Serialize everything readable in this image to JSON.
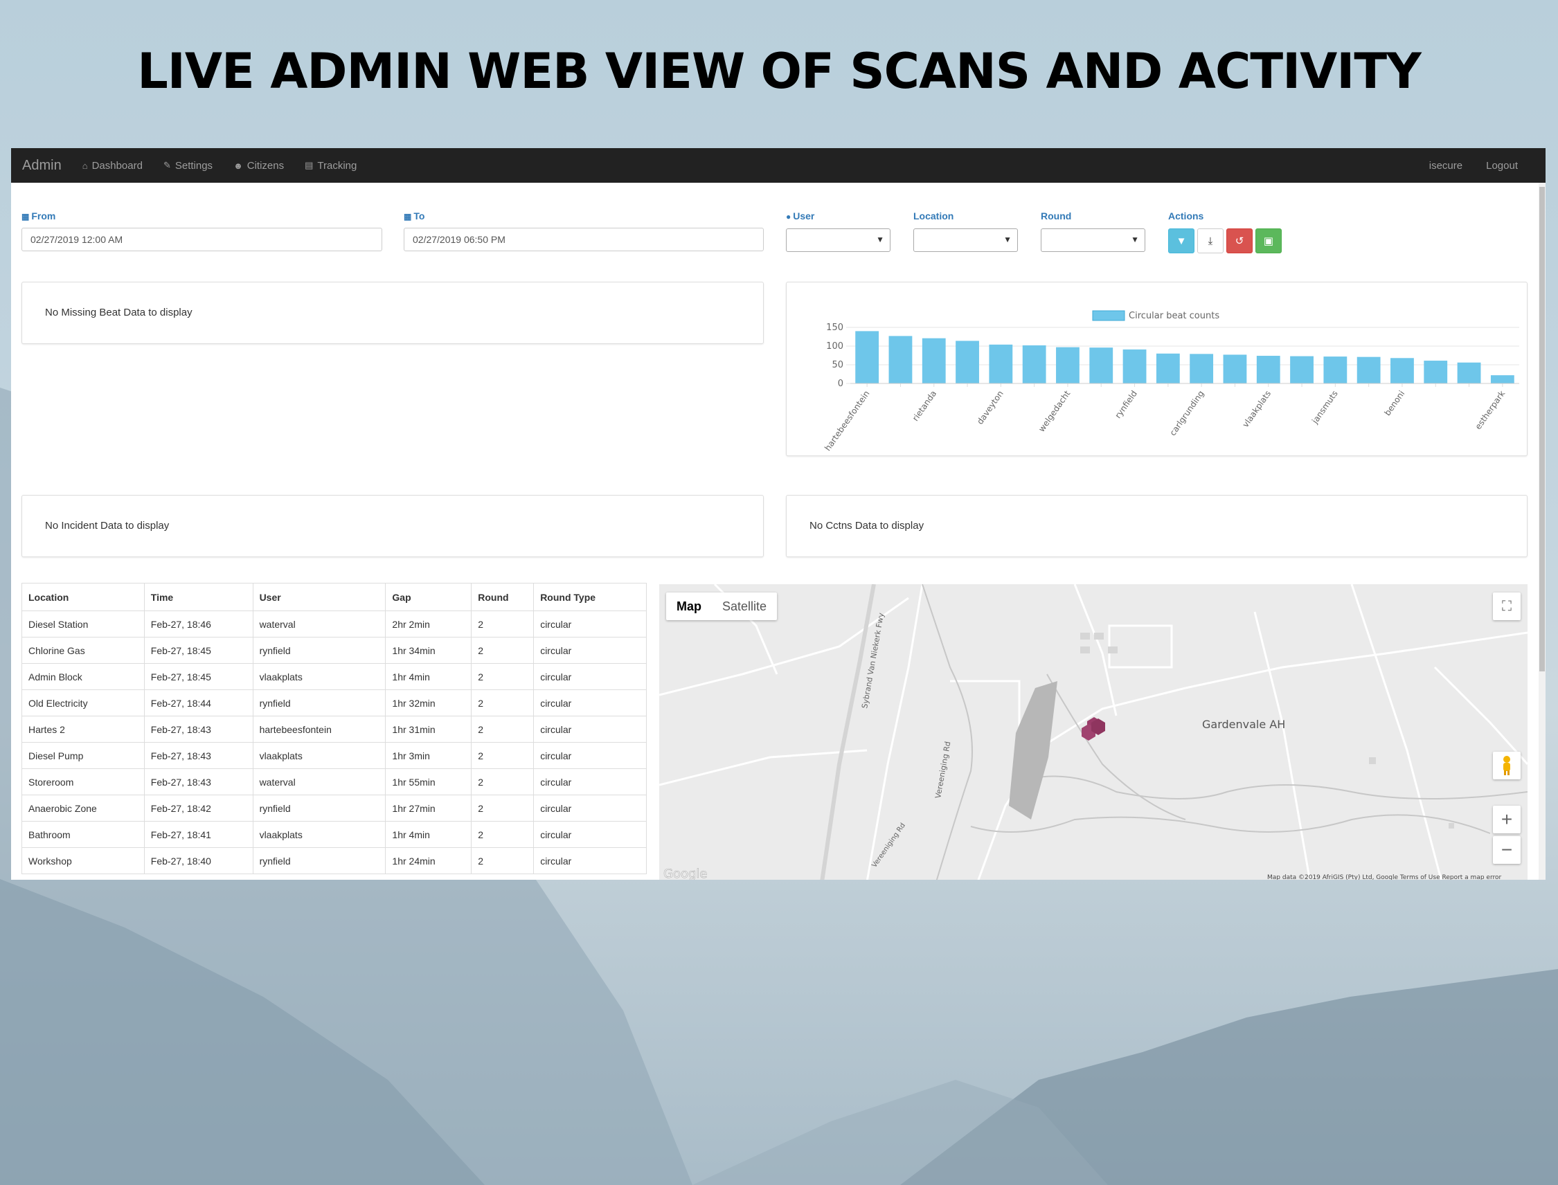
{
  "headline": "LIVE ADMIN WEB VIEW OF SCANS AND ACTIVITY",
  "navbar": {
    "brand": "Admin",
    "items": [
      {
        "label": "Dashboard",
        "icon": "home-icon"
      },
      {
        "label": "Settings",
        "icon": "wrench-icon"
      },
      {
        "label": "Citizens",
        "icon": "users-icon"
      },
      {
        "label": "Tracking",
        "icon": "map-icon"
      }
    ],
    "user": "isecure",
    "logout": "Logout"
  },
  "filters": {
    "from_label": "From",
    "from_value": "02/27/2019 12:00 AM",
    "to_label": "To",
    "to_value": "02/27/2019 06:50 PM",
    "user_label": "User",
    "location_label": "Location",
    "round_label": "Round",
    "actions_label": "Actions"
  },
  "actions": [
    {
      "name": "filter-button",
      "icon": "filter-icon",
      "color": "#5bc0de"
    },
    {
      "name": "download-button",
      "icon": "download-icon",
      "color": "#ffffff"
    },
    {
      "name": "reset-button",
      "icon": "undo-icon",
      "color": "#d9534f"
    },
    {
      "name": "image-button",
      "icon": "image-icon",
      "color": "#5cb85c"
    }
  ],
  "panels": {
    "missing_beat": "No Missing Beat Data to display",
    "incident": "No Incident Data to display",
    "cctns": "No Cctns Data to display"
  },
  "chart_data": {
    "type": "bar",
    "legend": "Circular beat counts",
    "color": "#6ec6ea",
    "ylim": [
      0,
      150
    ],
    "yticks": [
      "150",
      "100",
      "50",
      "0"
    ],
    "categories": [
      "hartebeesfontein",
      "",
      "rietanda",
      "",
      "daveyton",
      "",
      "welgedacht",
      "",
      "rynfield",
      "",
      "carlgrunding",
      "",
      "vlaakplats",
      "",
      "jansmuts",
      "",
      "benoni",
      "",
      "",
      "estherpark"
    ],
    "values": [
      140,
      127,
      121,
      114,
      104,
      102,
      97,
      96,
      91,
      80,
      79,
      77,
      74,
      73,
      72,
      71,
      68,
      61,
      56,
      22
    ]
  },
  "table": {
    "headers": [
      "Location",
      "Time",
      "User",
      "Gap",
      "Round",
      "Round Type"
    ],
    "rows": [
      [
        "Diesel Station",
        "Feb-27, 18:46",
        "waterval",
        "2hr 2min",
        "2",
        "circular"
      ],
      [
        "Chlorine Gas",
        "Feb-27, 18:45",
        "rynfield",
        "1hr 34min",
        "2",
        "circular"
      ],
      [
        "Admin Block",
        "Feb-27, 18:45",
        "vlaakplats",
        "1hr 4min",
        "2",
        "circular"
      ],
      [
        "Old Electricity",
        "Feb-27, 18:44",
        "rynfield",
        "1hr 32min",
        "2",
        "circular"
      ],
      [
        "Hartes 2",
        "Feb-27, 18:43",
        "hartebeesfontein",
        "1hr 31min",
        "2",
        "circular"
      ],
      [
        "Diesel Pump",
        "Feb-27, 18:43",
        "vlaakplats",
        "1hr 3min",
        "2",
        "circular"
      ],
      [
        "Storeroom",
        "Feb-27, 18:43",
        "waterval",
        "1hr 55min",
        "2",
        "circular"
      ],
      [
        "Anaerobic Zone",
        "Feb-27, 18:42",
        "rynfield",
        "1hr 27min",
        "2",
        "circular"
      ],
      [
        "Bathroom",
        "Feb-27, 18:41",
        "vlaakplats",
        "1hr 4min",
        "2",
        "circular"
      ],
      [
        "Workshop",
        "Feb-27, 18:40",
        "rynfield",
        "1hr 24min",
        "2",
        "circular"
      ]
    ]
  },
  "map": {
    "map_tab": "Map",
    "satellite_tab": "Satellite",
    "place_label": "Gardenvale AH",
    "road_1": "Sybrand Van Niekerk Fwy",
    "road_2": "Vereeniging Rd",
    "road_3": "Vereeniging Rd",
    "logo": "Google",
    "attribution": "Map data ©2019 AfriGIS (Pty) Ltd, Google   Terms of Use   Report a map error",
    "zoom_in": "+",
    "zoom_out": "−"
  }
}
